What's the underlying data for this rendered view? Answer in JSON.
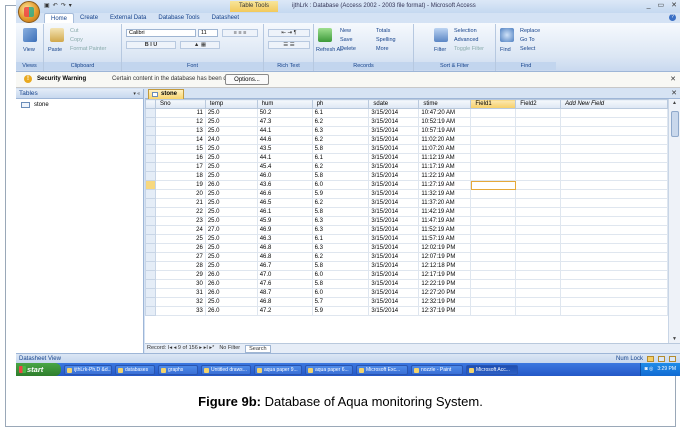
{
  "window": {
    "title": "ijthLrk : Database (Access 2002 - 2003 file format) - Microsoft Access",
    "context_tab": "Table Tools",
    "controls": [
      "_",
      "▭",
      "✕"
    ]
  },
  "ribbon": {
    "tabs": [
      "Home",
      "Create",
      "External Data",
      "Database Tools",
      "Datasheet"
    ],
    "groups": {
      "views": "Views",
      "clipboard": "Clipboard",
      "font": "Font",
      "rich_text": "Rich Text",
      "records": "Records",
      "sort_filter": "Sort & Filter",
      "find": "Find"
    },
    "view_label": "View",
    "paste_label": "Paste",
    "cut": "Cut",
    "copy": "Copy",
    "format_painter": "Format Painter",
    "font_name": "Calibri",
    "font_size": "11",
    "refresh": "Refresh All",
    "new": "New",
    "save": "Save",
    "delete": "Delete",
    "totals": "Totals",
    "spelling": "Spelling",
    "more": "More",
    "filter": "Filter",
    "selection": "Selection",
    "advanced": "Advanced",
    "toggle_filter": "Toggle Filter",
    "find_label": "Find",
    "replace": "Replace",
    "goto": "Go To",
    "select": "Select"
  },
  "security": {
    "label": "Security Warning",
    "message": "Certain content in the database has been disabled",
    "options": "Options..."
  },
  "nav": {
    "header": "Tables",
    "item": "stone"
  },
  "doc": {
    "tab": "stone"
  },
  "table": {
    "columns": [
      "Sno",
      "temp",
      "hum",
      "ph",
      "sdate",
      "stime",
      "Field1",
      "Field2",
      "Add New Field"
    ],
    "rows": [
      [
        "11",
        "25.0",
        "50.2",
        "6.1",
        "3/15/2014",
        "10:47:20 AM"
      ],
      [
        "12",
        "25.0",
        "47.3",
        "6.2",
        "3/15/2014",
        "10:52:19 AM"
      ],
      [
        "13",
        "25.0",
        "44.1",
        "6.3",
        "3/15/2014",
        "10:57:19 AM"
      ],
      [
        "14",
        "24.0",
        "44.6",
        "6.2",
        "3/15/2014",
        "11:02:20 AM"
      ],
      [
        "15",
        "25.0",
        "43.5",
        "5.8",
        "3/15/2014",
        "11:07:20 AM"
      ],
      [
        "16",
        "25.0",
        "44.1",
        "6.1",
        "3/15/2014",
        "11:12:19 AM"
      ],
      [
        "17",
        "25.0",
        "45.4",
        "6.2",
        "3/15/2014",
        "11:17:19 AM"
      ],
      [
        "18",
        "25.0",
        "46.0",
        "5.8",
        "3/15/2014",
        "11:22:19 AM"
      ],
      [
        "19",
        "26.0",
        "43.6",
        "6.0",
        "3/15/2014",
        "11:27:19 AM"
      ],
      [
        "20",
        "25.0",
        "46.6",
        "5.9",
        "3/15/2014",
        "11:32:19 AM"
      ],
      [
        "21",
        "25.0",
        "46.5",
        "6.2",
        "3/15/2014",
        "11:37:20 AM"
      ],
      [
        "22",
        "25.0",
        "46.1",
        "5.8",
        "3/15/2014",
        "11:42:19 AM"
      ],
      [
        "23",
        "25.0",
        "45.9",
        "6.3",
        "3/15/2014",
        "11:47:19 AM"
      ],
      [
        "24",
        "27.0",
        "46.9",
        "6.3",
        "3/15/2014",
        "11:52:19 AM"
      ],
      [
        "25",
        "25.0",
        "46.3",
        "6.1",
        "3/15/2014",
        "11:57:19 AM"
      ],
      [
        "26",
        "25.0",
        "46.8",
        "6.3",
        "3/15/2014",
        "12:02:19 PM"
      ],
      [
        "27",
        "25.0",
        "46.8",
        "6.2",
        "3/15/2014",
        "12:07:19 PM"
      ],
      [
        "28",
        "25.0",
        "46.7",
        "5.8",
        "3/15/2014",
        "12:12:18 PM"
      ],
      [
        "29",
        "26.0",
        "47.0",
        "6.0",
        "3/15/2014",
        "12:17:19 PM"
      ],
      [
        "30",
        "26.0",
        "47.6",
        "5.8",
        "3/15/2014",
        "12:22:19 PM"
      ],
      [
        "31",
        "26.0",
        "48.7",
        "6.0",
        "3/15/2014",
        "12:27:20 PM"
      ],
      [
        "32",
        "25.0",
        "46.8",
        "5.7",
        "3/15/2014",
        "12:32:19 PM"
      ],
      [
        "33",
        "26.0",
        "47.2",
        "5.9",
        "3/15/2014",
        "12:37:19 PM"
      ]
    ],
    "current_row": 8
  },
  "recbar": {
    "record": "Record: I◂ ◂ 9 of 156 ▸ ▸I ▸*",
    "filter": "No Filter",
    "search": "Search"
  },
  "statusbar": {
    "left": "Datasheet View",
    "right": "Num Lock"
  },
  "taskbar": {
    "start": "start",
    "items": [
      "ijthLrk-Ph.D &d...",
      "databases",
      "graphs",
      "Untitled draws...",
      "aqua paper 9...",
      "aqua paper 6...",
      "Microsoft Exc...",
      "nozzle - Paint",
      "Microsoft Acc..."
    ],
    "clock": "3:29 PM"
  },
  "caption": {
    "bold": "Figure 9b:",
    "rest": " Database of Aqua monitoring System."
  }
}
